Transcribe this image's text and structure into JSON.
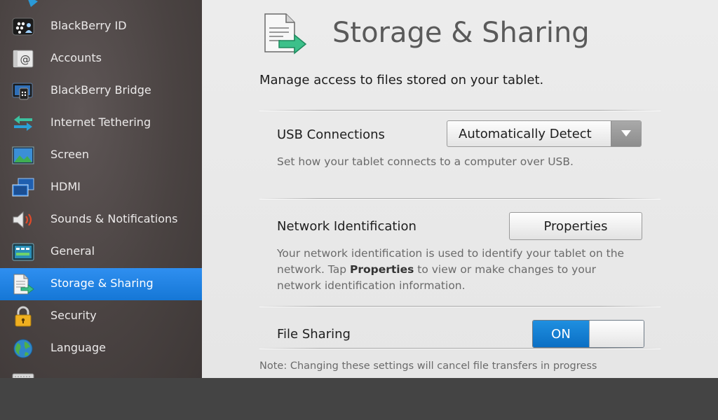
{
  "sidebar": {
    "items": [
      {
        "label": "BlackBerry ID",
        "icon": "blackberry-id-icon"
      },
      {
        "label": "Accounts",
        "icon": "accounts-icon"
      },
      {
        "label": "BlackBerry Bridge",
        "icon": "blackberry-bridge-icon"
      },
      {
        "label": "Internet Tethering",
        "icon": "internet-tethering-icon"
      },
      {
        "label": "Screen",
        "icon": "screen-icon"
      },
      {
        "label": "HDMI",
        "icon": "hdmi-icon"
      },
      {
        "label": "Sounds & Notifications",
        "icon": "speaker-icon"
      },
      {
        "label": "General",
        "icon": "general-icon"
      },
      {
        "label": "Storage & Sharing",
        "icon": "storage-sharing-icon",
        "active": true
      },
      {
        "label": "Security",
        "icon": "lock-icon"
      },
      {
        "label": "Language",
        "icon": "globe-icon"
      }
    ]
  },
  "main": {
    "title": "Storage & Sharing",
    "subtitle": "Manage access to files stored on your tablet.",
    "usb": {
      "label": "USB Connections",
      "selected_value": "Automatically Detect",
      "description": "Set how your tablet connects to a computer over USB."
    },
    "network": {
      "label": "Network Identification",
      "button_label": "Properties",
      "description_before": "Your network identification is used to identify your tablet on the network. Tap ",
      "description_bold": "Properties",
      "description_after": " to view or make changes to your network identification information."
    },
    "file_sharing": {
      "label": "File Sharing",
      "toggle_state": "ON"
    },
    "note": "Note: Changing these settings will cancel file transfers in progress"
  },
  "colors": {
    "active_item": "#1e85e6",
    "toggle_on": "#0b72c8",
    "bottom_bar": "#444444"
  }
}
